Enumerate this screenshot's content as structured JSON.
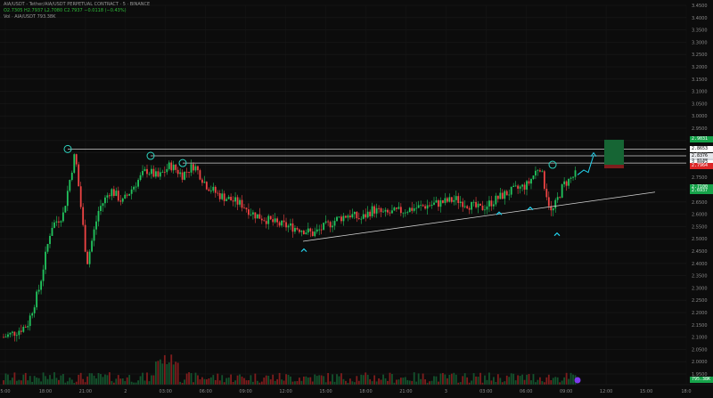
{
  "header": {
    "symbol": "AIA/USDT - Tether/AIA/USDT PERPETUAL CONTRACT · 5 · BINANCE",
    "ohlc": "O2.7305 H2.7937 L2.7080 C2.7937 −0.0118 (−0.43%)",
    "indicator": "Vol · AIA/USDT  793.38K"
  },
  "axis": {
    "y_labels": [
      "3.4500",
      "3.4000",
      "3.3500",
      "3.3000",
      "3.2500",
      "3.2000",
      "3.1500",
      "3.1000",
      "3.0500",
      "3.0000",
      "2.9500",
      "2.9000",
      "2.8500",
      "2.8000",
      "2.7500",
      "2.7000",
      "2.6500",
      "2.6000",
      "2.5500",
      "2.5000",
      "2.4500",
      "2.4000",
      "2.3500",
      "2.3000",
      "2.2500",
      "2.2000",
      "2.1500",
      "2.1000",
      "2.0500",
      "2.0000",
      "1.9500"
    ],
    "x_labels": [
      "5:00",
      "18:00",
      "21:00",
      "2",
      "03:00",
      "06:00",
      "09:00",
      "12:00",
      "15:00",
      "18:00",
      "21:00",
      "3",
      "03:00",
      "06:00",
      "09:00",
      "12:00",
      "15:00",
      "18:0"
    ]
  },
  "price_tags": [
    {
      "label": "2.9031",
      "color": "#16a34a"
    },
    {
      "label": "2.8653",
      "color": "#ffffff"
    },
    {
      "label": "2.8376",
      "color": "#e5e7eb"
    },
    {
      "label": "2.8138",
      "color": "#d1d5db"
    },
    {
      "label": "2.8082",
      "color": "#ffffff"
    },
    {
      "label": "2.8013",
      "color": "#ffffff"
    },
    {
      "label": "2.7964",
      "color": "#dc2626"
    },
    {
      "label": "2.7100",
      "color": "#16a34a"
    },
    {
      "label": "2.6937",
      "color": "#16a34a"
    },
    {
      "label": "795.38K",
      "color": "#16a34a"
    }
  ],
  "chart_data": {
    "type": "candlestick",
    "ylim": [
      1.95,
      3.45
    ],
    "x_ticks": [
      "5:00",
      "18:00",
      "21:00",
      "2",
      "03:00",
      "06:00",
      "09:00",
      "12:00",
      "15:00",
      "18:00",
      "21:00",
      "3",
      "03:00",
      "06:00",
      "09:00",
      "12:00",
      "15:00",
      "18:0"
    ],
    "resistance_levels": [
      2.8653,
      2.8376,
      2.8082
    ],
    "trendline": {
      "from": 2.49,
      "to": 2.69
    },
    "series": [
      {
        "values": [
          2.1,
          2.12,
          2.15,
          2.3,
          2.55,
          2.6,
          2.85,
          2.4,
          2.62,
          2.7,
          2.65,
          2.72,
          2.78,
          2.75,
          2.8,
          2.76,
          2.8,
          2.72,
          2.68,
          2.66,
          2.64,
          2.6,
          2.58,
          2.56,
          2.55,
          2.54,
          2.52,
          2.55,
          2.58,
          2.6,
          2.58,
          2.62,
          2.6,
          2.61,
          2.62,
          2.63,
          2.64,
          2.65,
          2.66,
          2.64,
          2.62,
          2.65,
          2.68,
          2.7,
          2.72,
          2.8,
          2.6,
          2.72,
          2.76
        ]
      }
    ]
  },
  "projection": {
    "target_label": "2.9031"
  },
  "buttons": {
    "settings": "⚙"
  }
}
